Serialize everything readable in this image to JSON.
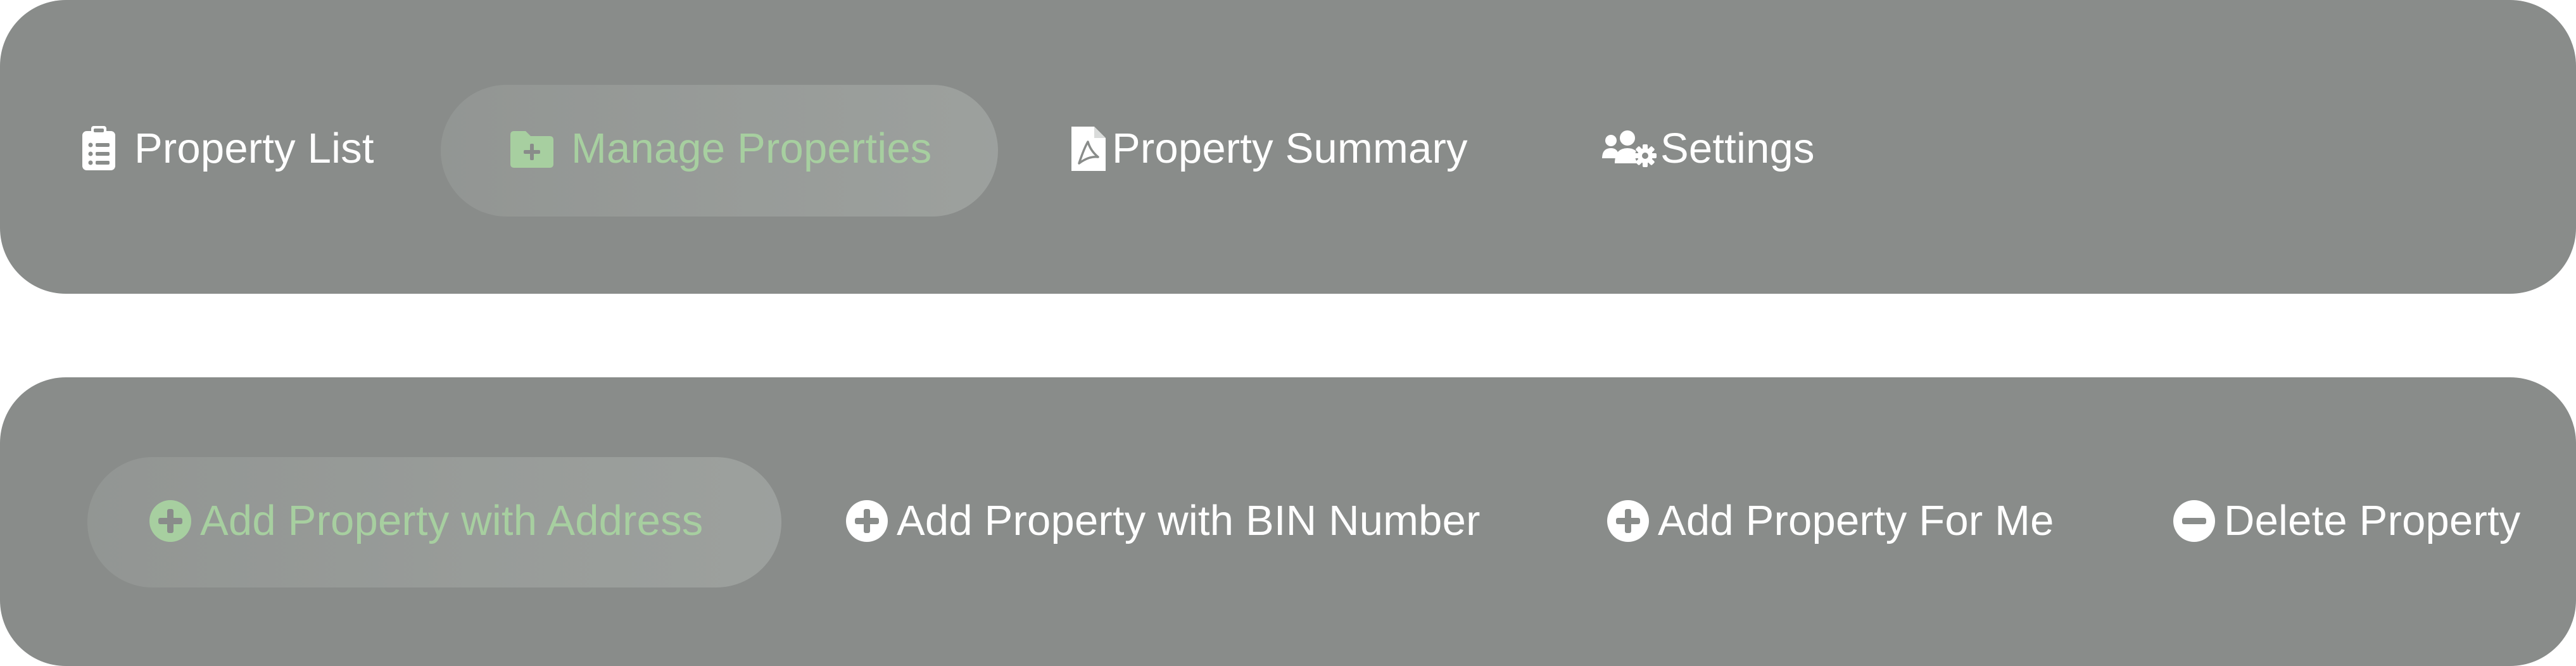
{
  "top_nav": {
    "items": [
      {
        "label": "Property List",
        "icon": "clipboard-list-icon",
        "active": false
      },
      {
        "label": "Manage Properties",
        "icon": "folder-plus-icon",
        "active": true
      },
      {
        "label": "Property Summary",
        "icon": "pdf-file-icon",
        "active": false
      },
      {
        "label": "Settings",
        "icon": "users-gear-icon",
        "active": false
      }
    ]
  },
  "sub_nav": {
    "items": [
      {
        "label": "Add Property with Address",
        "icon": "plus-circle-icon",
        "active": true
      },
      {
        "label": "Add Property with BIN Number",
        "icon": "plus-circle-icon",
        "active": false
      },
      {
        "label": "Add Property For Me",
        "icon": "plus-circle-icon",
        "active": false
      },
      {
        "label": "Delete Property",
        "icon": "minus-circle-icon",
        "active": false
      }
    ]
  },
  "colors": {
    "bar_background": "#898c8a",
    "active_text": "#a7cfa0",
    "inactive_text": "#ffffff",
    "page_background": "#ffffff"
  }
}
